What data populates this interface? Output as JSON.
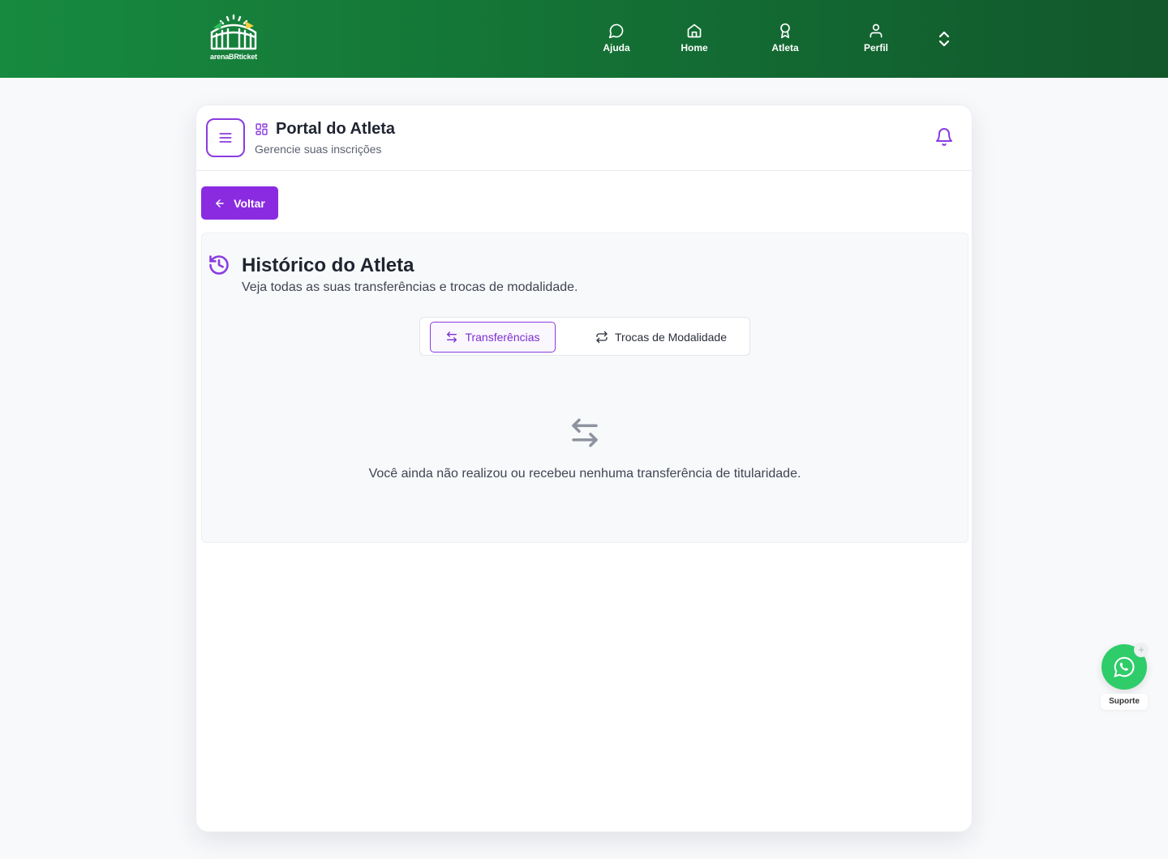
{
  "header": {
    "logo_text": "arenaBRticket",
    "nav": [
      {
        "label": "Ajuda",
        "icon": "chat-icon"
      },
      {
        "label": "Home",
        "icon": "home-icon"
      },
      {
        "label": "Atleta",
        "icon": "medal-icon"
      },
      {
        "label": "Perfil",
        "icon": "user-icon"
      }
    ]
  },
  "portal": {
    "title": "Portal do Atleta",
    "subtitle": "Gerencie suas inscrições"
  },
  "back_label": "Voltar",
  "history": {
    "title": "Histórico do Atleta",
    "subtitle": "Veja todas as suas transferências e trocas de modalidade.",
    "tabs": [
      {
        "label": "Transferências",
        "active": true
      },
      {
        "label": "Trocas de Modalidade",
        "active": false
      }
    ],
    "empty_message": "Você ainda não realizou ou recebeu nenhuma transferência de titularidade."
  },
  "support": {
    "label": "Suporte"
  },
  "colors": {
    "brand_green": "#178a3f",
    "accent_purple": "#8a2be2",
    "whatsapp_green": "#2fcc6a"
  }
}
